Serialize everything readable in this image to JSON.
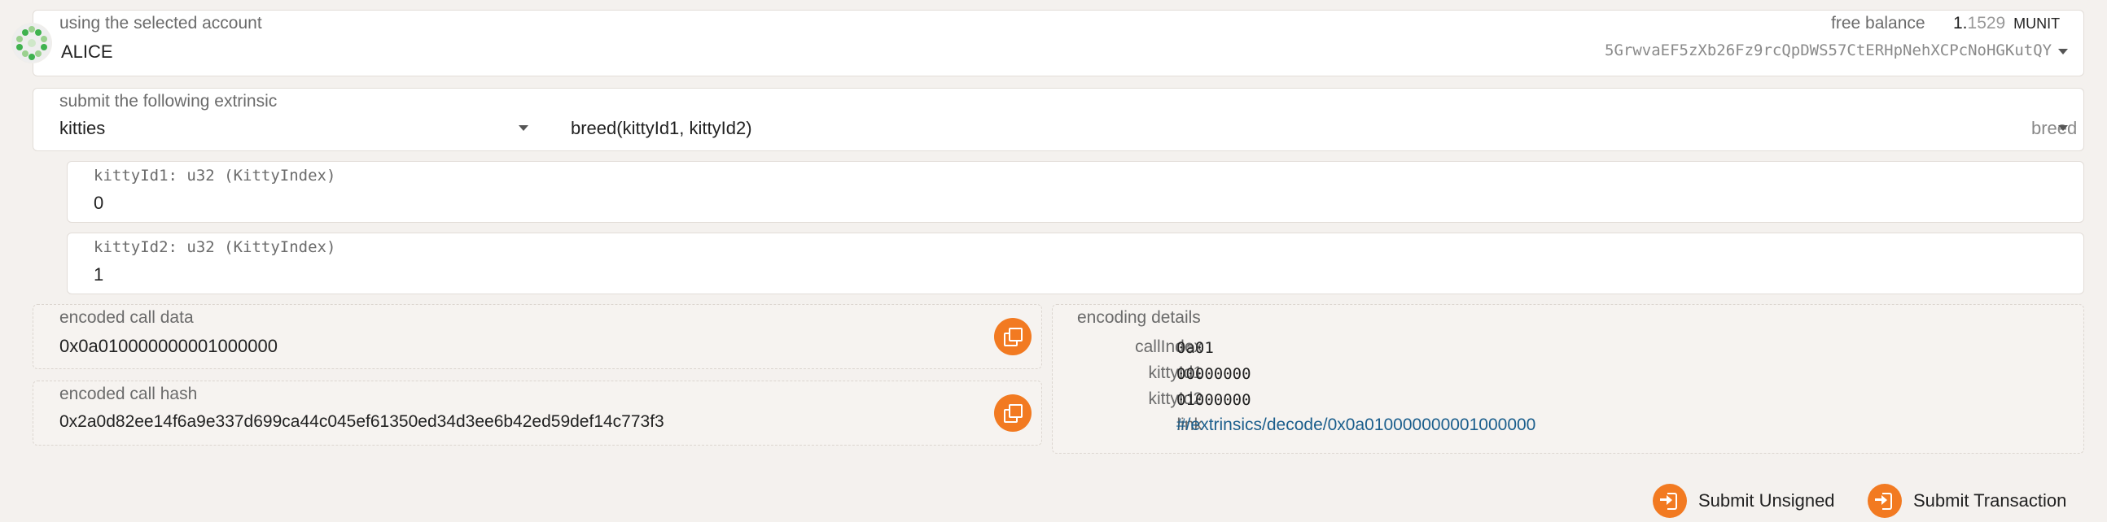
{
  "account": {
    "label": "using the selected account",
    "name": "ALICE",
    "balance_label": "free balance",
    "balance_int": "1.",
    "balance_frac": "1529",
    "balance_unit": "MUNIT",
    "address": "5GrwvaEF5zXb26Fz9rcQpDWS57CtERHpNehXCPcNoHGKutQY"
  },
  "extrinsic": {
    "label": "submit the following extrinsic",
    "section": "kitties",
    "signature": "breed(kittyId1, kittyId2)",
    "method": "breed"
  },
  "params": [
    {
      "label": "kittyId1: u32 (KittyIndex)",
      "value": "0"
    },
    {
      "label": "kittyId2: u32 (KittyIndex)",
      "value": "1"
    }
  ],
  "encoded": {
    "call_data_label": "encoded call data",
    "call_data": "0x0a010000000001000000",
    "call_hash_label": "encoded call hash",
    "call_hash": "0x2a0d82ee14f6a9e337d699ca44c045ef61350ed34d3ee6b42ed59def14c773f3"
  },
  "details": {
    "title": "encoding details",
    "rows": [
      {
        "label": "callIndex",
        "value": "0a01"
      },
      {
        "label": "kittyId1",
        "value": "00000000"
      },
      {
        "label": "kittyId2",
        "value": "01000000"
      },
      {
        "label": "link",
        "value": "#/extrinsics/decode/0x0a010000000001000000"
      }
    ]
  },
  "actions": {
    "unsigned": "Submit Unsigned",
    "transaction": "Submit Transaction"
  },
  "colors": {
    "accent": "#f27a21",
    "link": "#1b5e8c",
    "background": "#f4f1ee"
  }
}
